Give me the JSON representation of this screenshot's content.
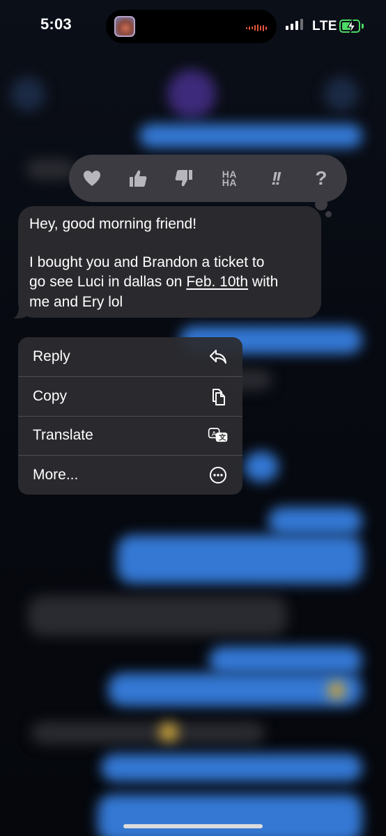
{
  "status_bar": {
    "time": "5:03",
    "network": "LTE",
    "battery_state": "charging",
    "accent_color": "#4cd964"
  },
  "dynamic_island": {
    "activity": "audio-recording",
    "wave_color": "#e4573c"
  },
  "tapbacks": [
    {
      "name": "heart-icon"
    },
    {
      "name": "thumbs-up-icon"
    },
    {
      "name": "thumbs-down-icon"
    },
    {
      "name": "haha-icon",
      "label_line1": "HA",
      "label_line2": "HA"
    },
    {
      "name": "exclamation-icon",
      "label": "!!"
    },
    {
      "name": "question-icon",
      "label": "?"
    }
  ],
  "message": {
    "line1": "Hey, good morning friend!",
    "line2": "I bought you and Brandon a ticket to",
    "line3_before": "go see Luci in dallas on ",
    "line3_link": "Feb. 10th",
    "line3_after": " with",
    "line4": "me and Ery lol"
  },
  "context_menu": {
    "items": [
      {
        "label": "Reply",
        "icon": "reply-arrow-icon"
      },
      {
        "label": "Copy",
        "icon": "copy-documents-icon"
      },
      {
        "label": "Translate",
        "icon": "translate-icon"
      },
      {
        "label": "More...",
        "icon": "more-ellipsis-icon"
      }
    ]
  },
  "colors": {
    "tapback_bar": "#3b3b41",
    "bubble_incoming": "#2a2a2e",
    "bubble_outgoing_blurred": "#3478d4"
  }
}
